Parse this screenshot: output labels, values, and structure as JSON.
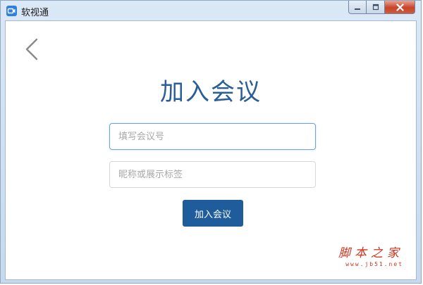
{
  "window": {
    "title": "软视通",
    "icon": "video-camera-icon",
    "controls": {
      "minimize": "minimize-icon",
      "maximize": "maximize-icon",
      "close": "close-icon"
    }
  },
  "page": {
    "back_icon": "chevron-left-icon",
    "title": "加入会议",
    "meeting_id_placeholder": "填写会议号",
    "meeting_id_value": "",
    "nickname_placeholder": "昵称或展示标签",
    "nickname_value": "",
    "join_label": "加入会议"
  },
  "watermark": {
    "name": "脚本之家",
    "url": "www.jb51.net"
  },
  "colors": {
    "title_color": "#2a5e97",
    "button_bg": "#1f5c9c",
    "watermark": "#d0341e"
  }
}
